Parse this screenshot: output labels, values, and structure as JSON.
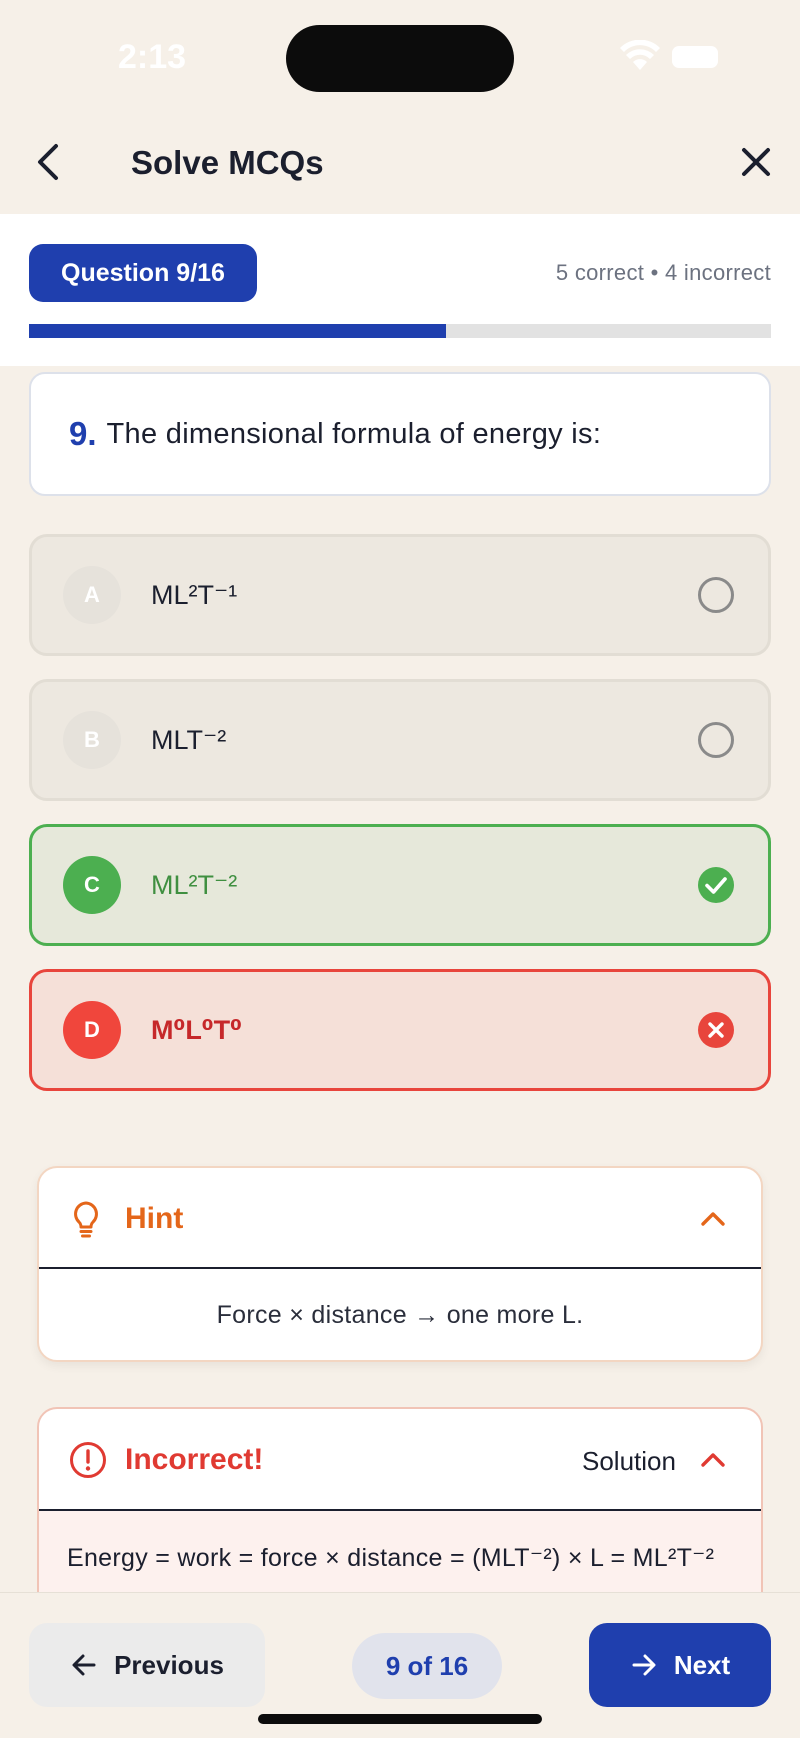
{
  "status_bar": {
    "time": "2:13"
  },
  "header": {
    "title": "Solve MCQs",
    "back_icon": "chevron-left-icon",
    "close_icon": "close-icon"
  },
  "progress": {
    "question_label": "Question 9/16",
    "score_text": "5 correct • 4 incorrect",
    "fraction": 0.5625,
    "colors": {
      "fill": "#1f3fae",
      "track": "#e2e2e2"
    }
  },
  "question": {
    "number": "9.",
    "text": "The dimensional formula of energy is:"
  },
  "options": [
    {
      "letter": "A",
      "text": "ML²T⁻¹",
      "state": "unselected"
    },
    {
      "letter": "B",
      "text": "MLT⁻²",
      "state": "unselected"
    },
    {
      "letter": "C",
      "text": "ML²T⁻²",
      "state": "correct"
    },
    {
      "letter": "D",
      "text": "M⁰L⁰T⁰",
      "state": "incorrect"
    }
  ],
  "hint": {
    "label": "Hint",
    "text": "Force × distance → one more L.",
    "icon": "lightbulb-icon",
    "expanded": true
  },
  "solution": {
    "status_label": "Incorrect!",
    "toggle_label": "Solution",
    "icon": "alert-circle-icon",
    "text": "Energy = work = force × distance = (MLT⁻²) × L = ML²T⁻²",
    "expanded": true
  },
  "footer": {
    "previous_label": "Previous",
    "page_indicator": "9 of 16",
    "next_label": "Next"
  },
  "colors": {
    "primary": "#1f3fae",
    "correct": "#4caf50",
    "incorrect": "#e8453c",
    "hint": "#e4661a",
    "background": "#f6f0e8"
  }
}
